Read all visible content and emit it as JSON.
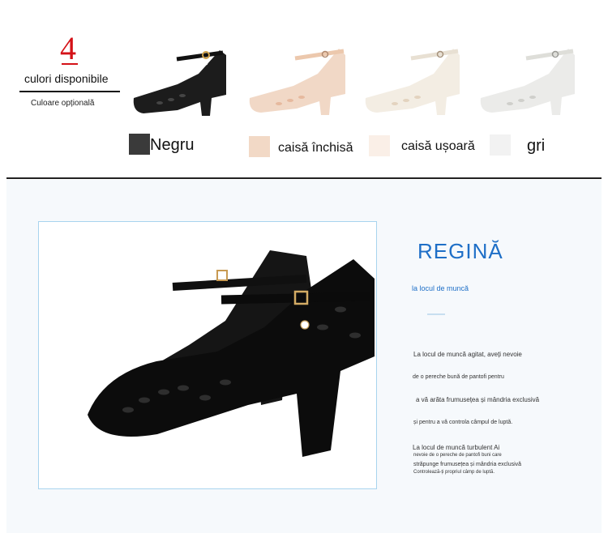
{
  "header": {
    "count": "4",
    "title": "culori disponibile",
    "subtitle": "Culoare opțională"
  },
  "colors": [
    {
      "label": "Negru",
      "swatch": "#3a3a3a",
      "shoe_color": "#1c1c1c",
      "accent": "#000000"
    },
    {
      "label": "caisă închisă",
      "swatch": "#f2d9c6",
      "shoe_color": "#f1d8c6",
      "accent": "#e6b99e"
    },
    {
      "label": "caisă ușoară",
      "swatch": "#faefe7",
      "shoe_color": "#f3ede3",
      "accent": "#e3d3bf"
    },
    {
      "label": "gri",
      "swatch": "#f2f2f2",
      "shoe_color": "#ebebe9",
      "accent": "#cfcfcb"
    }
  ],
  "product": {
    "brand": "REGINĂ",
    "tagline": "la locul de muncă",
    "paragraphs": [
      "La locul de muncă agitat, aveți nevoie",
      "de o pereche bună de pantofi pentru",
      "a vă arăta frumusețea și mândria exclusivă",
      "și pentru a vă controla câmpul de luptă.",
      "La locul de muncă turbulent Ai",
      "nevoie de o pereche de pantofi buni care",
      "străpunge frumusețea și mândria exclusivă",
      "Controlează-ți propriul câmp de luptă."
    ]
  }
}
